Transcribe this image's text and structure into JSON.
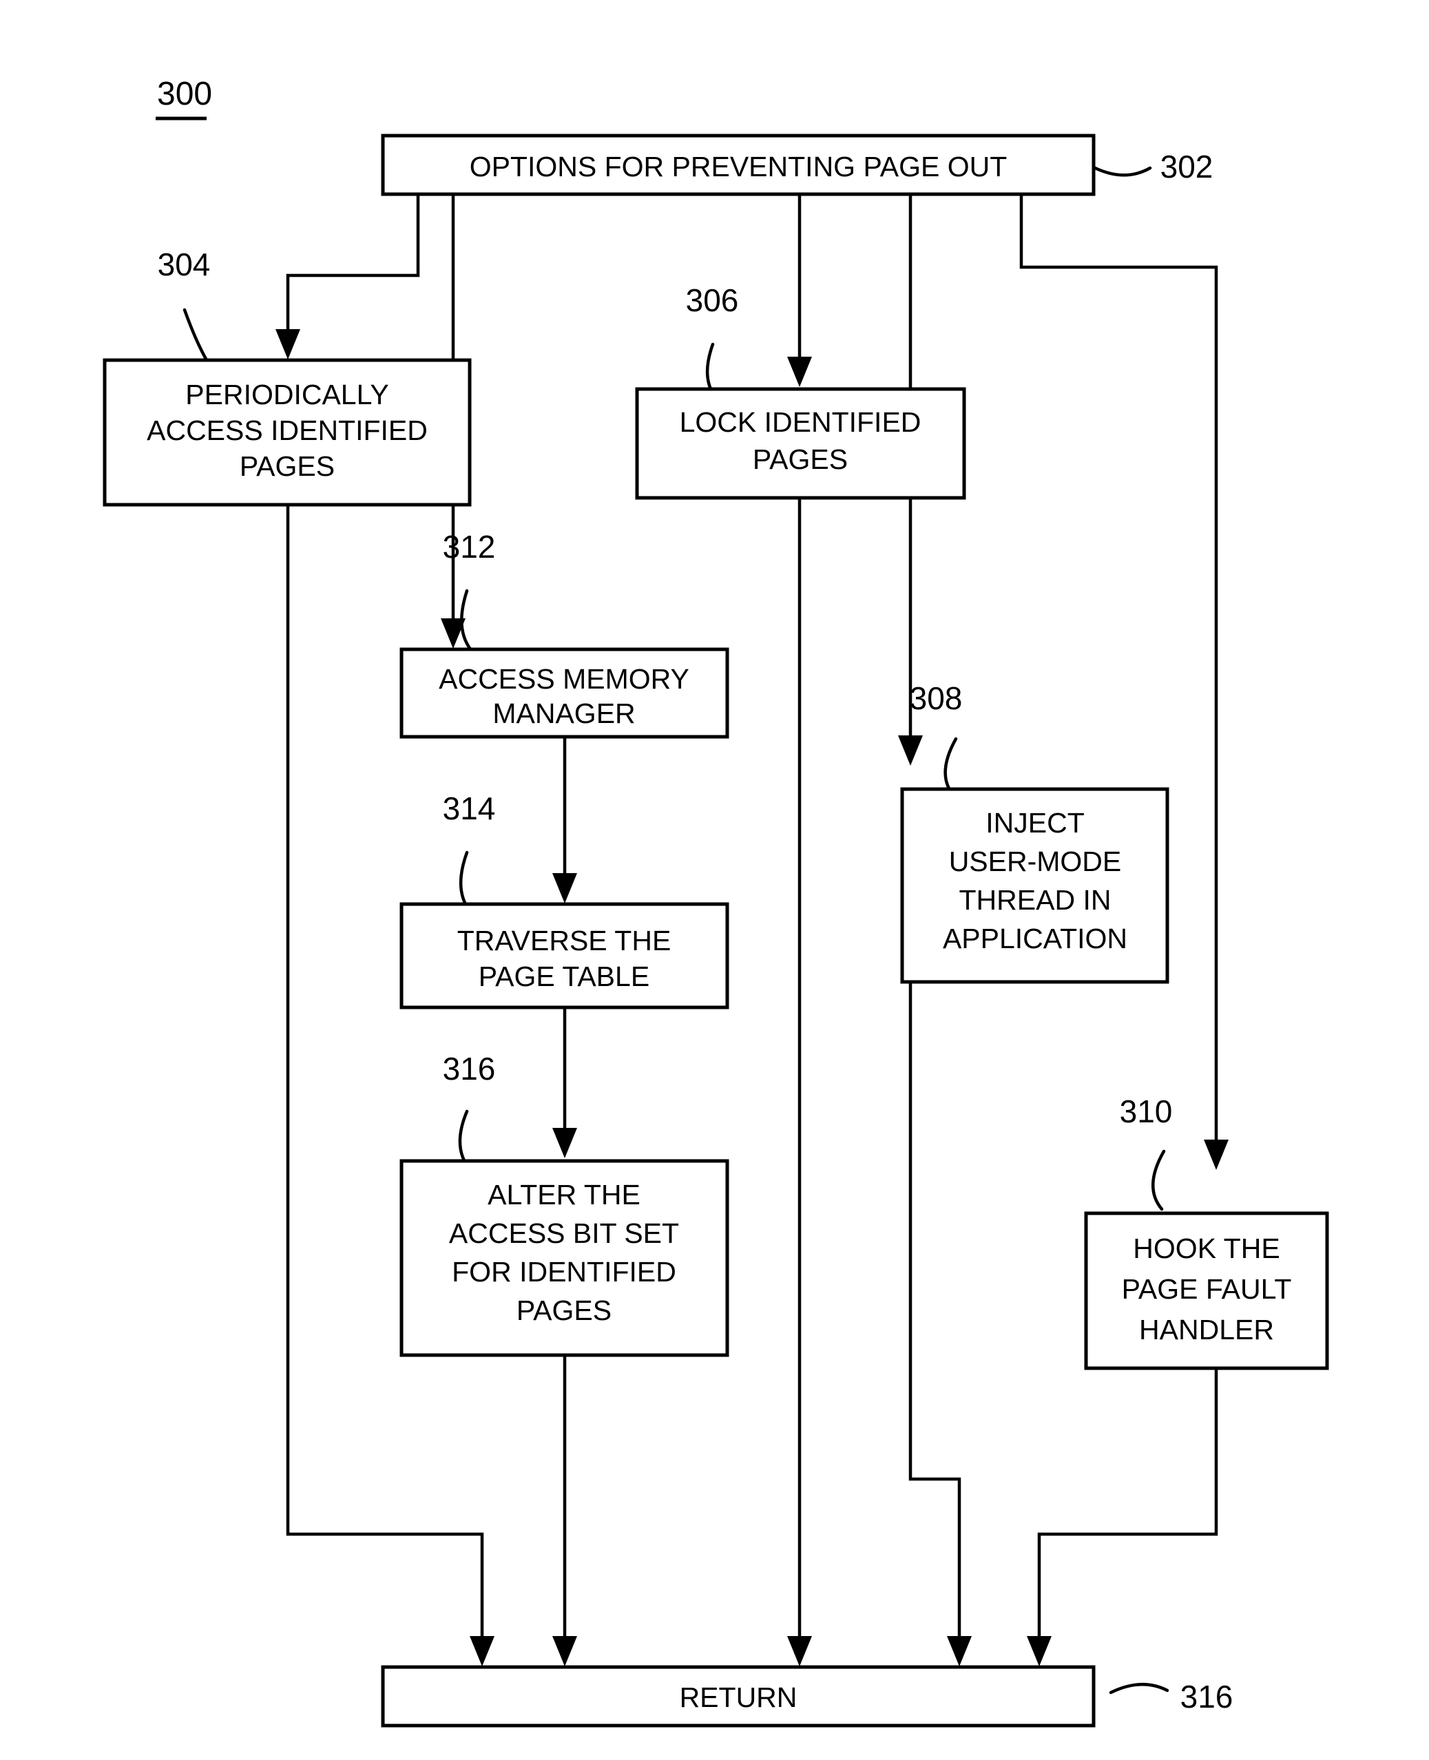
{
  "figure": {
    "number": "300"
  },
  "nodes": [
    {
      "id": "n302",
      "ref": "302",
      "lines": [
        "OPTIONS FOR PREVENTING PAGE OUT"
      ]
    },
    {
      "id": "n304",
      "ref": "304",
      "lines": [
        "PERIODICALLY",
        "ACCESS IDENTIFIED",
        "PAGES"
      ]
    },
    {
      "id": "n306",
      "ref": "306",
      "lines": [
        "LOCK IDENTIFIED",
        "PAGES"
      ]
    },
    {
      "id": "n312",
      "ref": "312",
      "lines": [
        "ACCESS MEMORY",
        "MANAGER"
      ]
    },
    {
      "id": "n308",
      "ref": "308",
      "lines": [
        "INJECT",
        "USER-MODE",
        "THREAD IN",
        "APPLICATION"
      ]
    },
    {
      "id": "n314",
      "ref": "314",
      "lines": [
        "TRAVERSE THE",
        "PAGE TABLE"
      ]
    },
    {
      "id": "n316a",
      "ref": "316",
      "lines": [
        "ALTER THE",
        "ACCESS BIT SET",
        "FOR IDENTIFIED",
        "PAGES"
      ]
    },
    {
      "id": "n310",
      "ref": "310",
      "lines": [
        "HOOK THE",
        "PAGE FAULT",
        "HANDLER"
      ]
    },
    {
      "id": "n316b",
      "ref": "316",
      "lines": [
        "RETURN"
      ]
    }
  ],
  "labels": {
    "fig_300": "300",
    "ref_302": "302",
    "ref_304": "304",
    "ref_306": "306",
    "ref_308": "308",
    "ref_310": "310",
    "ref_312": "312",
    "ref_314": "314",
    "ref_316_alter": "316",
    "ref_316_return": "316",
    "t302_l1": "OPTIONS FOR PREVENTING PAGE OUT",
    "t304_l1": "PERIODICALLY",
    "t304_l2": "ACCESS IDENTIFIED",
    "t304_l3": "PAGES",
    "t306_l1": "LOCK IDENTIFIED",
    "t306_l2": "PAGES",
    "t312_l1": "ACCESS MEMORY",
    "t312_l2": "MANAGER",
    "t308_l1": "INJECT",
    "t308_l2": "USER-MODE",
    "t308_l3": "THREAD IN",
    "t308_l4": "APPLICATION",
    "t314_l1": "TRAVERSE THE",
    "t314_l2": "PAGE TABLE",
    "t316a_l1": "ALTER THE",
    "t316a_l2": "ACCESS BIT SET",
    "t316a_l3": "FOR IDENTIFIED",
    "t316a_l4": "PAGES",
    "t310_l1": "HOOK THE",
    "t310_l2": "PAGE FAULT",
    "t310_l3": "HANDLER",
    "t316b_l1": "RETURN"
  },
  "colors": {
    "stroke": "#000000",
    "fill": "#ffffff",
    "text": "#000000"
  }
}
